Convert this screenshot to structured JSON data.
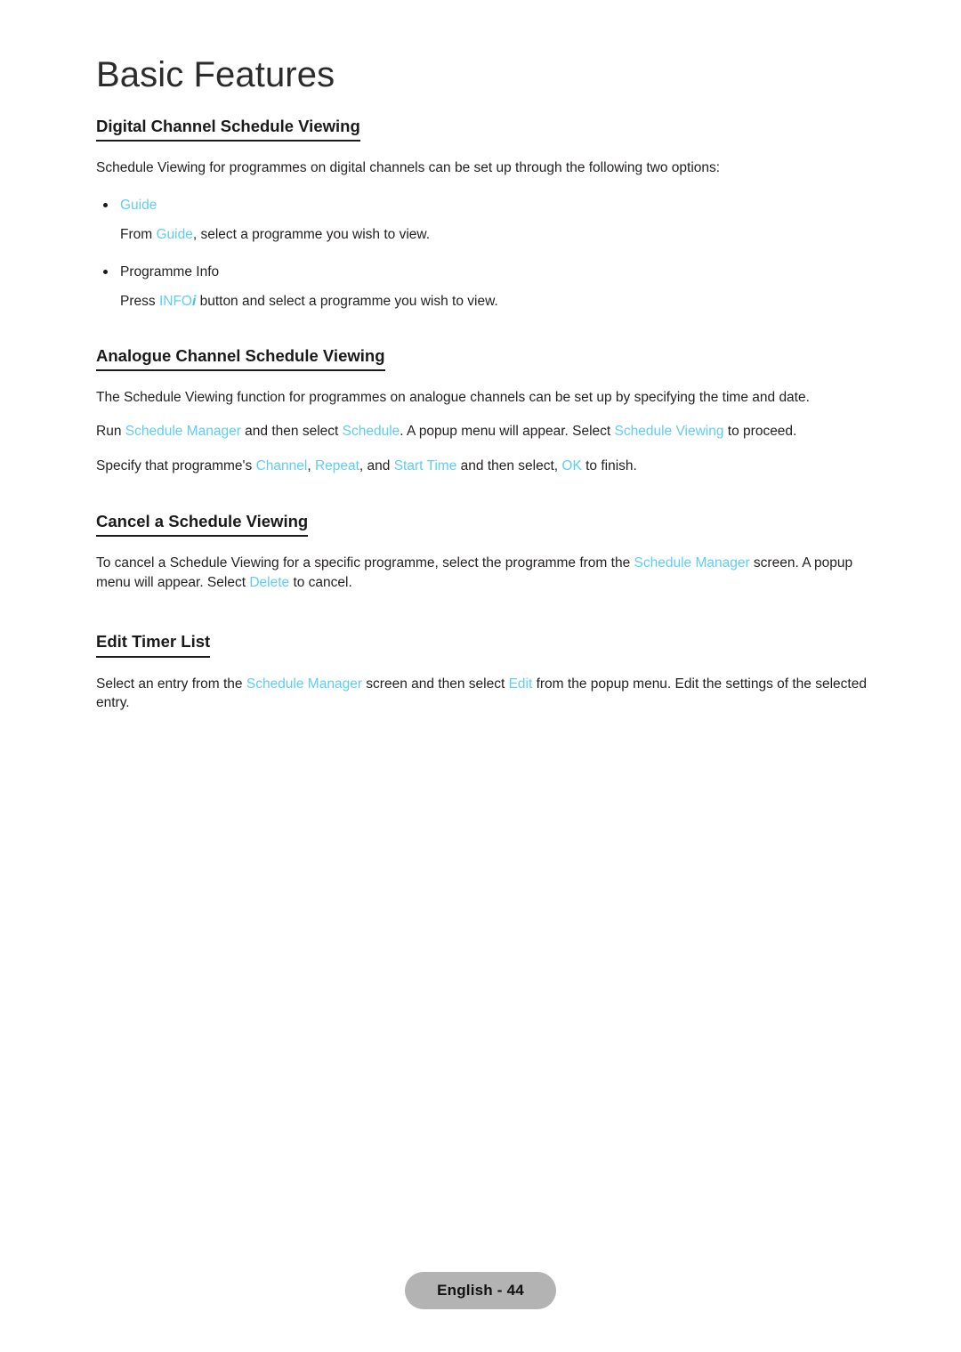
{
  "document": {
    "chapter_title": "Basic Features",
    "accent_color": "#5ecdf5",
    "text_color": "#231f20",
    "footer_pill_color": "#b3b3b3"
  },
  "sections": [
    {
      "heading": "Digital Channel Schedule Viewing",
      "intro": "Schedule Viewing for programmes on digital channels can be set up through the following two options:",
      "bullets": [
        {
          "label": "Guide",
          "label_is_ui": true,
          "description_pre": "From ",
          "description_ui": "Guide",
          "description_post": ", select a programme you wish to view."
        },
        {
          "label": "Programme Info",
          "label_is_ui": false,
          "description_pre": "Press ",
          "description_ui": "INFO",
          "description_ui_suffix": "i",
          "description_post": " button and select a programme you wish to view."
        }
      ]
    },
    {
      "heading": "Analogue Channel Schedule Viewing",
      "paragraphs": [
        {
          "p1": "The Schedule Viewing function for programmes on analogue channels can be set up by specifying the time and date."
        },
        {
          "seg1": "Run ",
          "ui1": "Schedule Manager",
          "seg2": " and then select ",
          "ui2": "Schedule",
          "seg3": ". A popup menu will appear. Select ",
          "ui3": "Schedule Viewing",
          "seg4": " to proceed."
        },
        {
          "seg1": "Specify that programme's ",
          "ui1": "Channel",
          "seg2": ", ",
          "ui2": "Repeat",
          "seg3": ", and ",
          "ui3": "Start Time",
          "seg4": " and then select, ",
          "ui4": "OK",
          "seg5": " to finish."
        }
      ]
    },
    {
      "heading": "Cancel a Schedule Viewing",
      "paragraph": {
        "seg1": "To cancel a Schedule Viewing for a specific programme, select the programme from the ",
        "ui1": "Schedule Manager",
        "seg2": " screen. A popup menu will appear. Select ",
        "ui2": "Delete",
        "seg3": " to cancel."
      }
    },
    {
      "heading": "Edit Timer List",
      "paragraph": {
        "seg1": "Select an entry from the ",
        "ui1": "Schedule Manager",
        "seg2": " screen and then select ",
        "ui2": "Edit",
        "seg3": " from the popup menu. Edit the settings of the selected entry."
      }
    }
  ],
  "footer": {
    "page_label": "English - 44"
  }
}
